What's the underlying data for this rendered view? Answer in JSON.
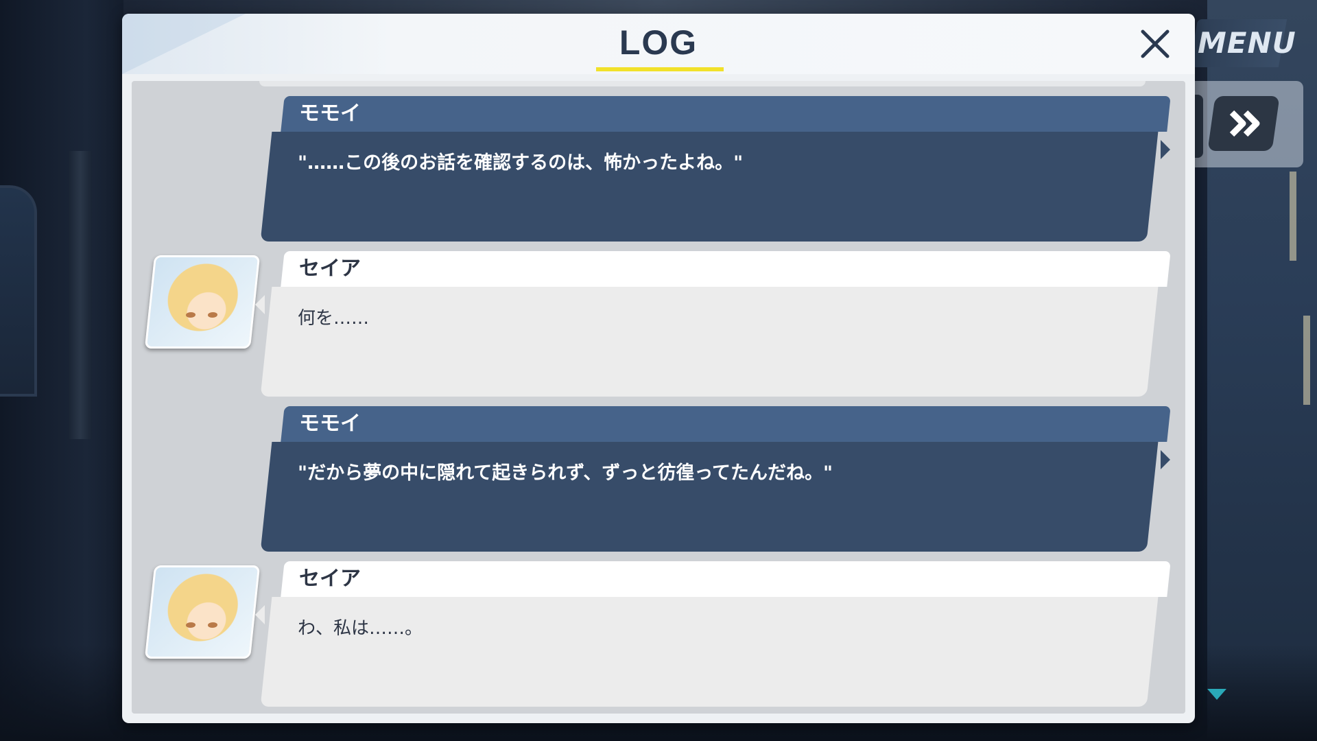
{
  "menu": {
    "label": "MENU"
  },
  "controls": {
    "fast_forward_icon": "fast-forward-icon",
    "scroll_down_icon": "down-triangle-icon"
  },
  "log": {
    "title": "LOG",
    "close_icon": "close-icon",
    "entries": [
      {
        "speaker": "モモイ",
        "text": "\"……この後のお話を確認するのは、怖かったよね。\"",
        "type": "player",
        "portrait": false
      },
      {
        "speaker": "セイア",
        "text": "何を……",
        "type": "character",
        "portrait": true
      },
      {
        "speaker": "モモイ",
        "text": "\"だから夢の中に隠れて起きられず、ずっと彷徨ってたんだね。\"",
        "type": "player",
        "portrait": false
      },
      {
        "speaker": "セイア",
        "text": "わ、私は……。",
        "type": "character",
        "portrait": true
      }
    ]
  },
  "colors": {
    "player_name_bg": "#46638a",
    "player_text_bg": "#374c69",
    "character_name_bg": "#ffffff",
    "character_text_bg": "#ececec",
    "title_accent": "#f1e12a"
  }
}
